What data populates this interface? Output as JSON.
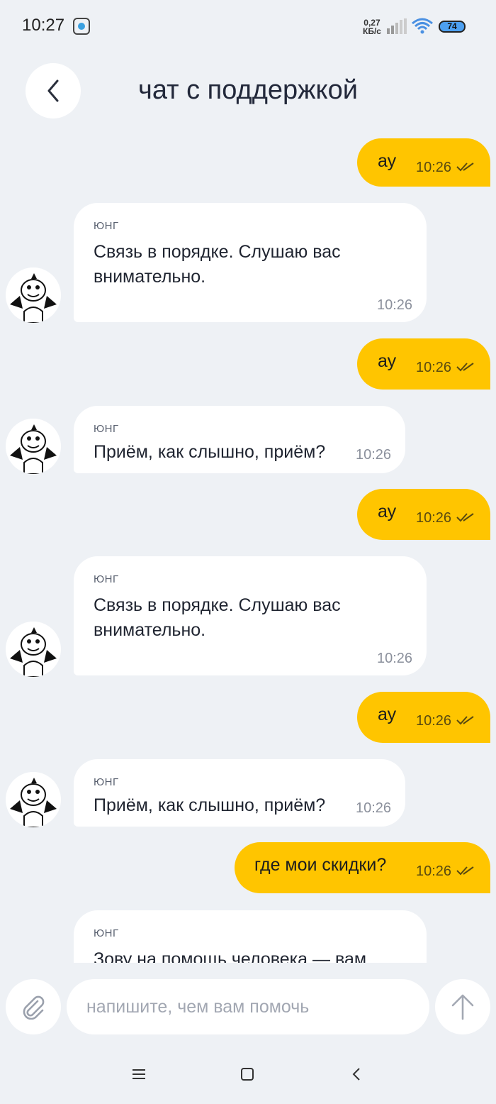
{
  "status_bar": {
    "time": "10:27",
    "net_speed_value": "0,27",
    "net_speed_unit": "КБ/с",
    "battery": "74"
  },
  "header": {
    "title": "чат с поддержкой"
  },
  "messages": [
    {
      "type": "outgoing",
      "text": "ау",
      "time": "10:26",
      "status": "read"
    },
    {
      "type": "incoming",
      "sender": "ЮНГ",
      "text": "Связь в порядке. Слушаю вас внимательно.",
      "time": "10:26"
    },
    {
      "type": "outgoing",
      "text": "ау",
      "time": "10:26",
      "status": "read"
    },
    {
      "type": "incoming",
      "sender": "ЮНГ",
      "text": "Приём, как слышно, приём?",
      "time": "10:26"
    },
    {
      "type": "outgoing",
      "text": "ау",
      "time": "10:26",
      "status": "read"
    },
    {
      "type": "incoming",
      "sender": "ЮНГ",
      "text": "Связь в порядке. Слушаю вас внимательно.",
      "time": "10:26"
    },
    {
      "type": "outgoing",
      "text": "ау",
      "time": "10:26",
      "status": "read"
    },
    {
      "type": "incoming",
      "sender": "ЮНГ",
      "text": "Приём, как слышно, приём?",
      "time": "10:26"
    },
    {
      "type": "outgoing",
      "text": "где мои скидки?",
      "time": "10:26",
      "status": "read"
    },
    {
      "type": "incoming",
      "sender": "ЮНГ",
      "text": "Зову на помощь человека — вам"
    }
  ],
  "composer": {
    "placeholder": "напишите, чем вам помочь",
    "value": ""
  },
  "icons": {
    "back": "chevron-left-icon",
    "attach": "paperclip-icon",
    "send": "arrow-up-icon",
    "nav_menu": "menu-icon",
    "nav_home": "square-icon",
    "nav_back": "triangle-back-icon"
  },
  "colors": {
    "background": "#eef1f5",
    "outgoing_bubble": "#ffc500",
    "incoming_bubble": "#ffffff"
  }
}
